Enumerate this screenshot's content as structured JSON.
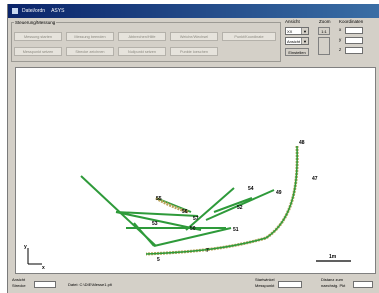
{
  "window": {
    "title_parts": [
      "Datei/ordn",
      "ASYS"
    ]
  },
  "control_group": {
    "legend": "Steuerung/Messung",
    "buttons_row1": [
      "Messung starten",
      "Messung beenden",
      "Abbrechen/Hilfe",
      "Weiche/Wechsel",
      "Punkt/Koordinate"
    ],
    "buttons_row2": [
      "Messpunkt setzen",
      "Strecke zeichnen",
      "Nullpunkt setzen",
      "Punkte loeschen"
    ]
  },
  "ansicht": {
    "label": "Ansicht",
    "select1": "XX",
    "select2": "Ansicht",
    "button": "Einstellen"
  },
  "zoom": {
    "label": "Zoom",
    "value": "1:1"
  },
  "koordinaten": {
    "label": "Koordinaten",
    "x_label": "x",
    "y_label": "y",
    "z_label": "z"
  },
  "canvas": {
    "point_labels": [
      "48",
      "47",
      "49",
      "54",
      "52",
      "51",
      "50",
      "53",
      "55",
      "56",
      "57",
      "5",
      "7"
    ],
    "scale_label": "1m",
    "axis_x_label": "x",
    "axis_y_label": "y"
  },
  "statusbar": {
    "left_label_1": "Ansicht",
    "left_label_2": "Strecke",
    "file_label": "Datei: C:\\DIE\\Messe1.plt",
    "mid_label_1": "Startwinkel",
    "mid_label_2": "Messpunkt",
    "right_label_1": "Distanz zum",
    "right_label_2": "naechstg. Pkt"
  },
  "colors": {
    "track": "#2e9a3a",
    "curve_dash": "#b9a45a",
    "title_bar": "#0a246a"
  }
}
